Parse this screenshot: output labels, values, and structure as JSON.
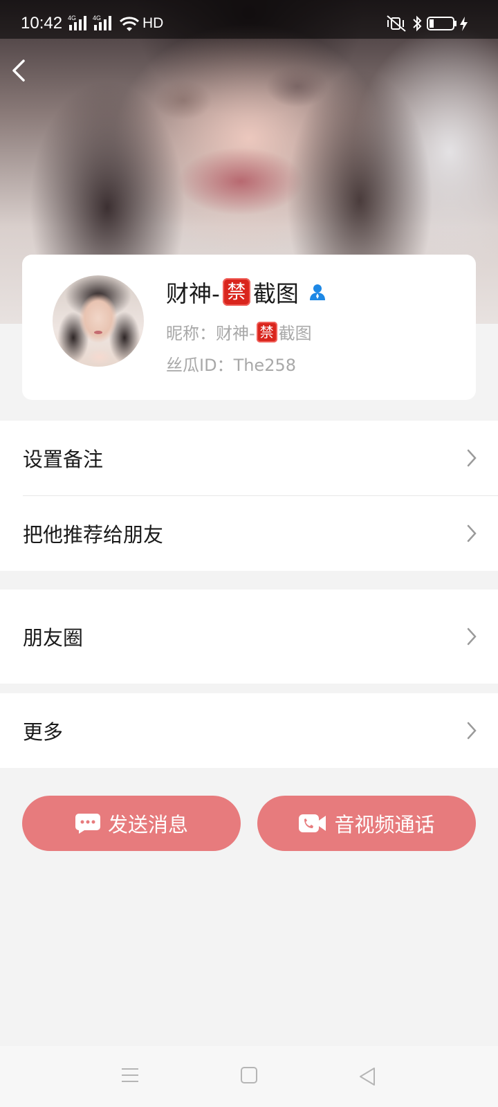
{
  "status_bar": {
    "time": "10:42",
    "signal_1": "4G",
    "signal_2": "4G",
    "hd": "HD"
  },
  "profile": {
    "display_name_prefix": "财神-",
    "display_name_badge": "禁",
    "display_name_suffix": "截图",
    "nickname_label": "昵称：",
    "nickname_prefix": "财神-",
    "nickname_badge": "禁",
    "nickname_suffix": "截图",
    "id_label": "丝瓜ID：",
    "id_value": "The258"
  },
  "menu": {
    "set_remark": "设置备注",
    "recommend_to_friend": "把他推荐给朋友",
    "moments": "朋友圈",
    "more": "更多"
  },
  "actions": {
    "send_message": "发送消息",
    "av_call": "音视频通话"
  },
  "colors": {
    "accent_button": "#e77b7d",
    "ban_badge": "#d9251d",
    "verified_icon": "#1e88e5"
  }
}
